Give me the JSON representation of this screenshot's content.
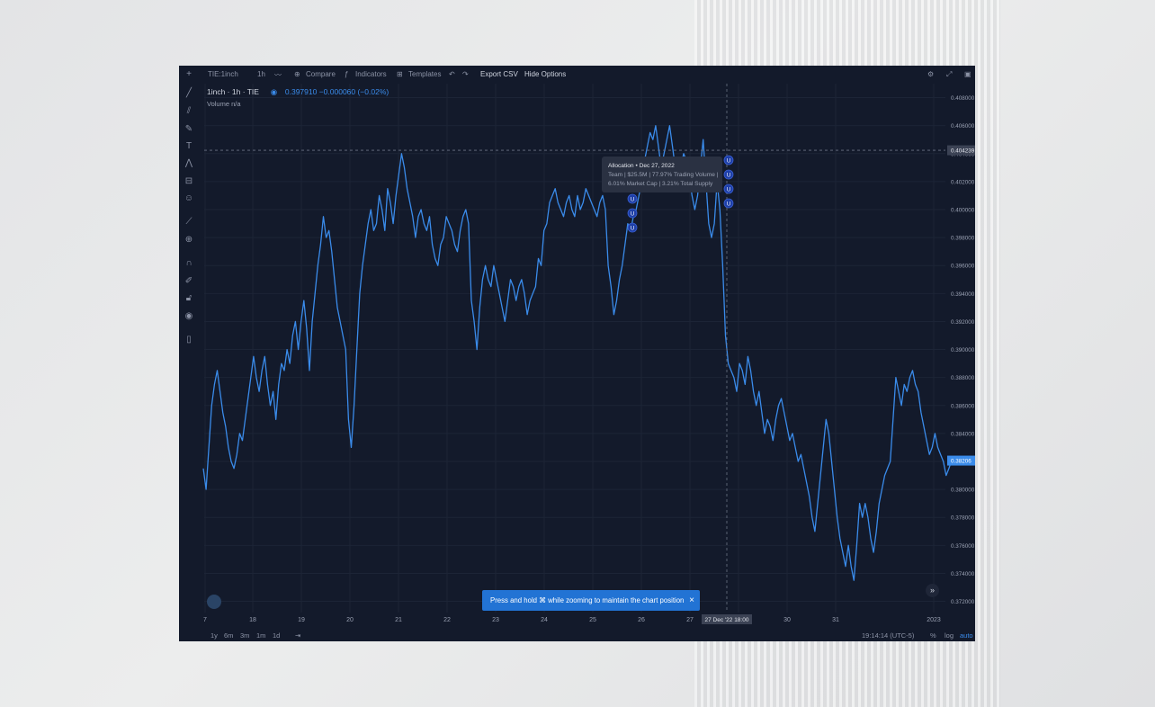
{
  "topbar": {
    "symbol": "TIE:1inch",
    "interval": "1h",
    "compare": "Compare",
    "indicators": "Indicators",
    "templates": "Templates",
    "export": "Export CSV",
    "hide_options": "Hide Options"
  },
  "legend": {
    "title": "1inch · 1h · TIE",
    "price": "0.397910",
    "change": "−0.000060 (−0.02%)",
    "volume_label": "Volume",
    "volume_value": "n/a"
  },
  "tooltip": {
    "title": "Allocation",
    "date": "Dec 27, 2022",
    "line1": "Team | $25.5M | 77.97% Trading Volume |",
    "line2": "6.01% Market Cap | 3.21% Total Supply",
    "marker_letter": "U"
  },
  "toast": {
    "text": "Press and hold ⌘ while zooming to maintain the chart position",
    "close": "×"
  },
  "bottombar": {
    "ranges": [
      "1y",
      "6m",
      "3m",
      "1m",
      "1d"
    ],
    "time": "19:14:14 (UTC-5)",
    "percent": "%",
    "log": "log",
    "auto": "auto"
  },
  "chart_data": {
    "type": "line",
    "x_ticks": [
      "7",
      "18",
      "19",
      "20",
      "21",
      "22",
      "23",
      "24",
      "25",
      "26",
      "27",
      "29",
      "30",
      "31",
      "2023"
    ],
    "crosshair_x_label": "27 Dec '22   18:00",
    "crosshair_y_label": "0.404239",
    "last_price_label": "0.38206",
    "y_ticks": [
      "0.408000",
      "0.406000",
      "0.404000",
      "0.402000",
      "0.400000",
      "0.398000",
      "0.396000",
      "0.394000",
      "0.392000",
      "0.390000",
      "0.388000",
      "0.386000",
      "0.384000",
      "0.382000",
      "0.380000",
      "0.378000",
      "0.376000",
      "0.374000",
      "0.372000"
    ],
    "ylim": [
      0.3712,
      0.409
    ],
    "series_color": "#3a8bea",
    "series": [
      {
        "values": [
          0.3815,
          0.38,
          0.383,
          0.386,
          0.3875,
          0.3885,
          0.387,
          0.3855,
          0.3845,
          0.383,
          0.382,
          0.3815,
          0.3825,
          0.384,
          0.3835,
          0.385,
          0.3865,
          0.388,
          0.3895,
          0.388,
          0.387,
          0.3885,
          0.3895,
          0.3875,
          0.386,
          0.387,
          0.385,
          0.3875,
          0.389,
          0.3885,
          0.39,
          0.389,
          0.391,
          0.392,
          0.39,
          0.392,
          0.3935,
          0.3915,
          0.3885,
          0.392,
          0.394,
          0.396,
          0.3975,
          0.3995,
          0.398,
          0.3985,
          0.397,
          0.395,
          0.393,
          0.392,
          0.391,
          0.39,
          0.385,
          0.383,
          0.386,
          0.39,
          0.394,
          0.396,
          0.3975,
          0.399,
          0.4,
          0.3985,
          0.399,
          0.401,
          0.4,
          0.3985,
          0.4015,
          0.4005,
          0.399,
          0.401,
          0.4025,
          0.404,
          0.403,
          0.4015,
          0.4005,
          0.3995,
          0.398,
          0.3995,
          0.4,
          0.399,
          0.3985,
          0.3995,
          0.3975,
          0.3965,
          0.396,
          0.3975,
          0.398,
          0.3995,
          0.399,
          0.3985,
          0.3975,
          0.397,
          0.3985,
          0.3995,
          0.4,
          0.399,
          0.3935,
          0.392,
          0.39,
          0.393,
          0.395,
          0.396,
          0.395,
          0.3945,
          0.396,
          0.395,
          0.394,
          0.393,
          0.392,
          0.3935,
          0.395,
          0.3945,
          0.3935,
          0.3945,
          0.395,
          0.394,
          0.3925,
          0.3935,
          0.394,
          0.3945,
          0.3965,
          0.396,
          0.3985,
          0.399,
          0.4005,
          0.401,
          0.4015,
          0.4005,
          0.4,
          0.3995,
          0.4005,
          0.401,
          0.4,
          0.3995,
          0.401,
          0.4,
          0.4005,
          0.4015,
          0.401,
          0.4005,
          0.4,
          0.3995,
          0.4005,
          0.401,
          0.4,
          0.396,
          0.3945,
          0.3925,
          0.3935,
          0.395,
          0.396,
          0.3975,
          0.399,
          0.3985,
          0.3995,
          0.4,
          0.401,
          0.402,
          0.4035,
          0.4045,
          0.4055,
          0.405,
          0.406,
          0.4045,
          0.403,
          0.404,
          0.405,
          0.406,
          0.4045,
          0.403,
          0.402,
          0.403,
          0.404,
          0.4035,
          0.4025,
          0.401,
          0.4,
          0.401,
          0.403,
          0.405,
          0.402,
          0.399,
          0.398,
          0.399,
          0.402,
          0.4,
          0.396,
          0.391,
          0.389,
          0.3885,
          0.388,
          0.387,
          0.389,
          0.3885,
          0.3875,
          0.3895,
          0.3885,
          0.387,
          0.386,
          0.387,
          0.3855,
          0.384,
          0.385,
          0.3845,
          0.3835,
          0.385,
          0.386,
          0.3865,
          0.3855,
          0.3845,
          0.3835,
          0.384,
          0.383,
          0.382,
          0.3825,
          0.3815,
          0.3805,
          0.3795,
          0.378,
          0.377,
          0.379,
          0.381,
          0.383,
          0.385,
          0.384,
          0.382,
          0.38,
          0.378,
          0.3765,
          0.3755,
          0.3745,
          0.376,
          0.3745,
          0.3735,
          0.376,
          0.379,
          0.378,
          0.379,
          0.378,
          0.3765,
          0.3755,
          0.377,
          0.379,
          0.38,
          0.381,
          0.3815,
          0.382,
          0.385,
          0.388,
          0.387,
          0.386,
          0.3875,
          0.387,
          0.388,
          0.3885,
          0.3875,
          0.387,
          0.3855,
          0.3845,
          0.3835,
          0.3825,
          0.383,
          0.384,
          0.383,
          0.3825,
          0.382,
          0.381,
          0.3815,
          0.3821
        ]
      }
    ]
  }
}
